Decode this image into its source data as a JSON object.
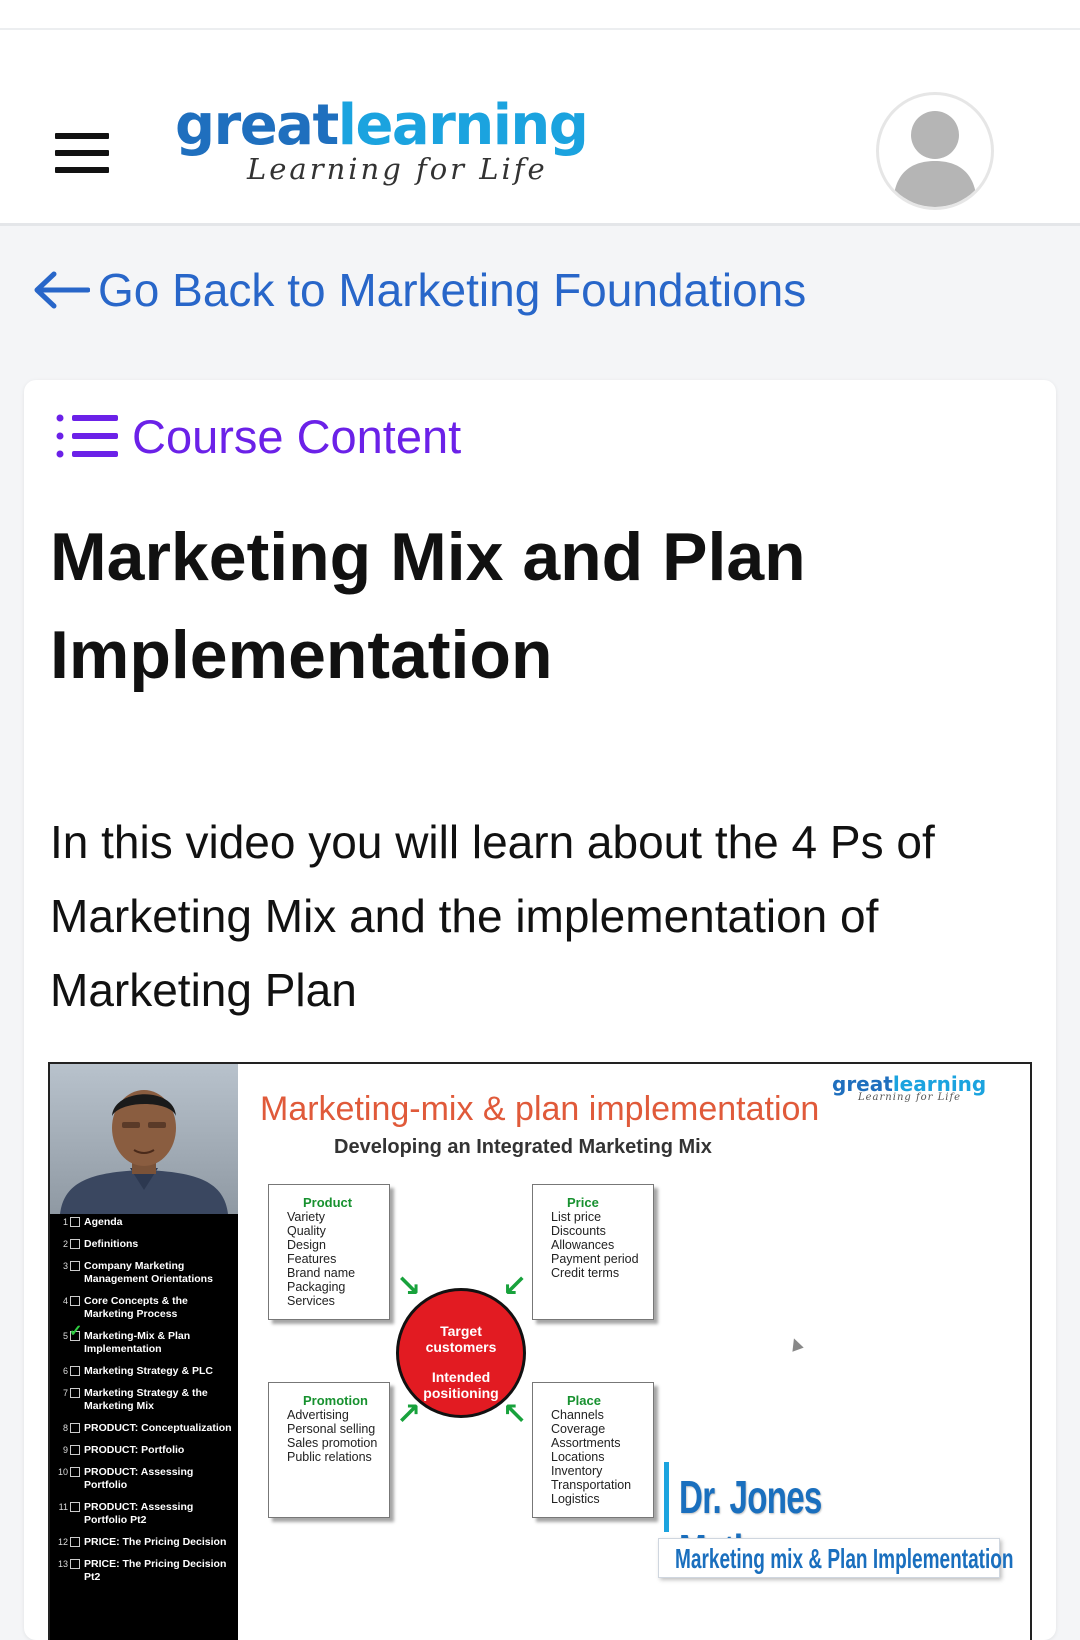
{
  "header": {
    "logo": {
      "word_a": "great",
      "word_b": "learning",
      "tagline": "Learning for Life"
    },
    "menu_icon": "hamburger-menu-icon",
    "avatar_icon": "user-avatar-icon"
  },
  "back_link": {
    "icon": "arrow-left-icon",
    "label": "Go Back to Marketing Foundations"
  },
  "course_content": {
    "icon": "list-icon",
    "label": "Course Content"
  },
  "lesson": {
    "title": "Marketing Mix and Plan Implementation",
    "description": "In this video you will learn about the 4 Ps of Marketing Mix and the implementation of Marketing Plan"
  },
  "video": {
    "agenda": [
      {
        "num": "1",
        "label": "Agenda",
        "checked": false
      },
      {
        "num": "2",
        "label": "Definitions",
        "checked": false
      },
      {
        "num": "3",
        "label": "Company Marketing Management Orientations",
        "checked": false
      },
      {
        "num": "4",
        "label": "Core Concepts & the Marketing Process",
        "checked": false
      },
      {
        "num": "5",
        "label": "Marketing-Mix & Plan Implementation",
        "checked": true
      },
      {
        "num": "6",
        "label": "Marketing Strategy & PLC",
        "checked": false
      },
      {
        "num": "7",
        "label": "Marketing Strategy & the Marketing Mix",
        "checked": false
      },
      {
        "num": "8",
        "label": "PRODUCT: Conceptualization",
        "checked": false
      },
      {
        "num": "9",
        "label": "PRODUCT: Portfolio",
        "checked": false
      },
      {
        "num": "10",
        "label": "PRODUCT: Assessing Portfolio",
        "checked": false
      },
      {
        "num": "11",
        "label": "PRODUCT: Assessing Portfolio Pt2",
        "checked": false
      },
      {
        "num": "12",
        "label": "PRICE: The Pricing Decision",
        "checked": false
      },
      {
        "num": "13",
        "label": "PRICE: The Pricing Decision Pt2",
        "checked": false
      }
    ],
    "slide_logo": {
      "word_a": "great",
      "word_b": "learning",
      "tagline": "Learning for Life"
    },
    "slide_title": "Marketing-mix & plan implementation",
    "slide_subtitle": "Developing an Integrated Marketing Mix",
    "product": {
      "heading": "Product",
      "items": [
        "Variety",
        "Quality",
        "Design",
        "Features",
        "Brand name",
        "Packaging",
        "Services"
      ]
    },
    "price": {
      "heading": "Price",
      "items": [
        "List price",
        "Discounts",
        "Allowances",
        "Payment period",
        "Credit terms"
      ]
    },
    "promotion": {
      "heading": "Promotion",
      "items": [
        "Advertising",
        "Personal selling",
        "Sales promotion",
        "Public relations"
      ]
    },
    "place": {
      "heading": "Place",
      "items": [
        "Channels",
        "Coverage",
        "Assortments",
        "Locations",
        "Inventory",
        "Transportation",
        "Logistics"
      ]
    },
    "center": {
      "line1": "Target",
      "line2": "customers",
      "line3": "Intended",
      "line4": "positioning"
    },
    "presenter_name": "Dr. Jones Mathew",
    "presenter_caption": "Marketing mix & Plan Implementation"
  },
  "colors": {
    "logo_dark_blue": "#1f6fbe",
    "logo_light_blue": "#1ba3df",
    "back_link_blue": "#2866c9",
    "course_content_purple": "#6b21e8",
    "slide_title_orange": "#e05a3a",
    "four_p_green": "#17912f",
    "target_red": "#e21b22"
  }
}
